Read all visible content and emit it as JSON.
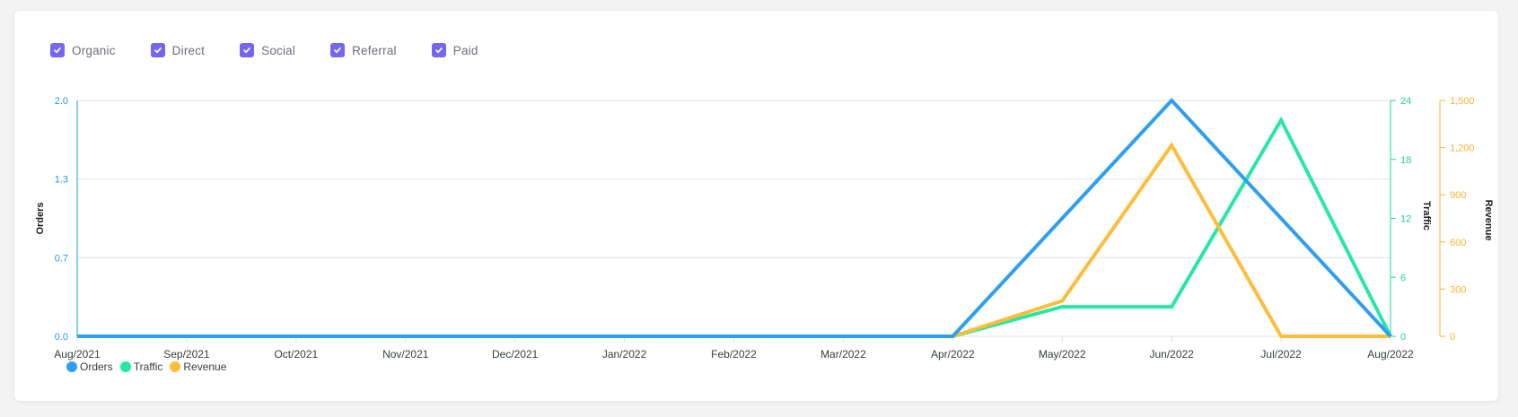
{
  "filters": [
    {
      "label": "Organic",
      "checked": true
    },
    {
      "label": "Direct",
      "checked": true
    },
    {
      "label": "Social",
      "checked": true
    },
    {
      "label": "Referral",
      "checked": true
    },
    {
      "label": "Paid",
      "checked": true
    }
  ],
  "colors": {
    "checkbox": "#7367f0",
    "orders": "#2e9ff0",
    "traffic": "#26e7a6",
    "revenue": "#febc3b",
    "grid": "#e3e3e3",
    "axis_orders": "#1a9bee",
    "axis_traffic": "#20d6a0",
    "axis_revenue": "#f7b331"
  },
  "chart_data": {
    "type": "line",
    "categories": [
      "Aug/2021",
      "Sep/2021",
      "Oct/2021",
      "Nov/2021",
      "Dec/2021",
      "Jan/2022",
      "Feb/2022",
      "Mar/2022",
      "Apr/2022",
      "May/2022",
      "Jun/2022",
      "Jul/2022",
      "Aug/2022"
    ],
    "series": [
      {
        "name": "Orders",
        "axis": "orders",
        "values": [
          0,
          0,
          0,
          0,
          0,
          0,
          0,
          0,
          0,
          1,
          2,
          1,
          0
        ]
      },
      {
        "name": "Traffic",
        "axis": "traffic",
        "values": [
          0,
          0,
          0,
          0,
          0,
          0,
          0,
          0,
          0,
          3,
          3,
          22,
          0
        ]
      },
      {
        "name": "Revenue",
        "axis": "revenue",
        "values": [
          0,
          0,
          0,
          0,
          0,
          0,
          0,
          0,
          0,
          225,
          1215,
          0,
          0
        ]
      }
    ],
    "axes": {
      "orders": {
        "label": "Orders",
        "min": 0,
        "max": 2,
        "ticks": [
          "0.0",
          "0.7",
          "1.3",
          "2.0"
        ],
        "position": "left"
      },
      "traffic": {
        "label": "Traffic",
        "min": 0,
        "max": 24,
        "ticks": [
          "0",
          "6",
          "12",
          "18",
          "24"
        ],
        "position": "right"
      },
      "revenue": {
        "label": "Revenue",
        "min": 0,
        "max": 1500,
        "ticks": [
          "0",
          "300",
          "600",
          "900",
          "1,200",
          "1,500"
        ],
        "position": "right"
      }
    },
    "grid": true,
    "legend_position": "bottom-left"
  }
}
